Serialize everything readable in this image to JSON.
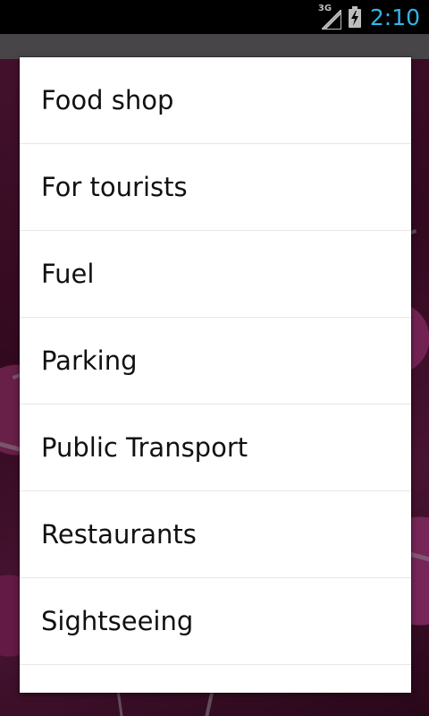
{
  "status_bar": {
    "network_label": "3G",
    "time": "2:10",
    "icons": [
      "signal-icon",
      "battery-charging-icon"
    ],
    "clock_color": "#33b5e5"
  },
  "dialog": {
    "items": [
      {
        "label": "Food shop"
      },
      {
        "label": "For tourists"
      },
      {
        "label": "Fuel"
      },
      {
        "label": "Parking"
      },
      {
        "label": "Public Transport"
      },
      {
        "label": "Restaurants"
      },
      {
        "label": "Sightseeing"
      },
      {
        "label": ""
      }
    ]
  }
}
